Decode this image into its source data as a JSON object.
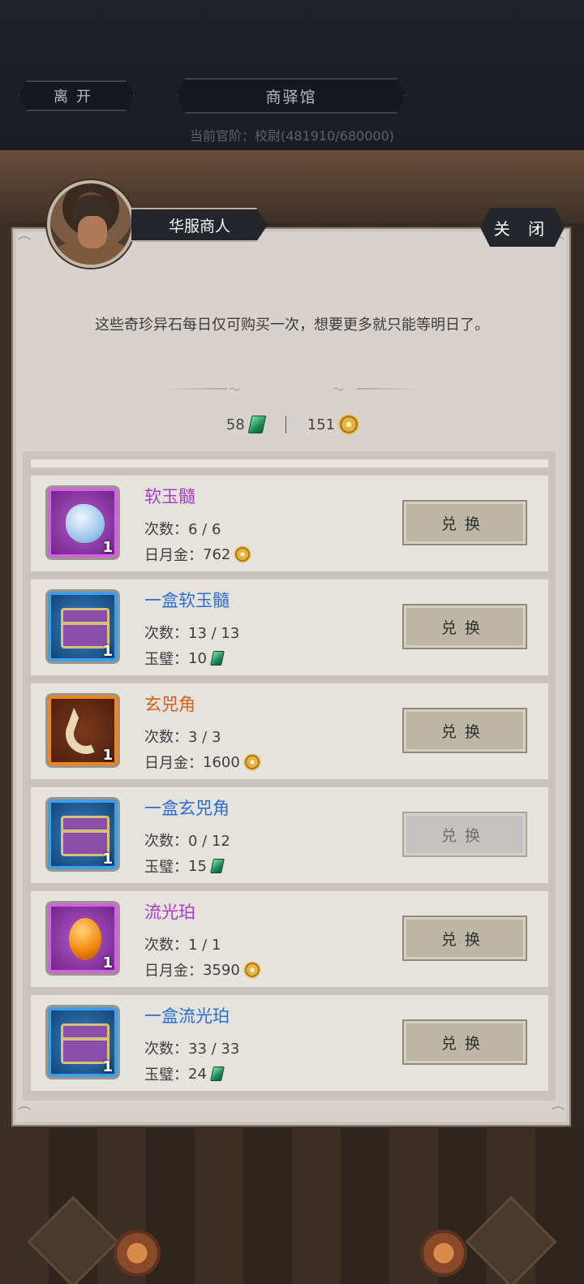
{
  "header": {
    "leave_label": "离开",
    "title": "商驿馆",
    "rank_text": "当前官阶：校尉(481910/680000)"
  },
  "dialog": {
    "merchant_name": "华服商人",
    "close_label": "关 闭",
    "message": "这些奇珍异石每日仅可购买一次，想要更多就只能等明日了。"
  },
  "currency": {
    "jade": "58",
    "gold": "151"
  },
  "items": [
    {
      "name": "软玉髓",
      "rarity": "purple",
      "icon": "blue-jade-stone-icon",
      "qty": "1",
      "count": "次数：6 / 6",
      "cost_label": "日月金：",
      "cost": "762",
      "cost_icon": "gold",
      "button": "兑换",
      "enabled": true
    },
    {
      "name": "一盒软玉髓",
      "rarity": "blue",
      "icon": "treasure-chest-icon",
      "qty": "1",
      "count": "次数：13 / 13",
      "cost_label": "玉璧：",
      "cost": "10",
      "cost_icon": "jade",
      "button": "兑换",
      "enabled": true
    },
    {
      "name": "玄兕角",
      "rarity": "orange",
      "icon": "horn-icon",
      "qty": "1",
      "count": "次数：3 / 3",
      "cost_label": "日月金：",
      "cost": "1600",
      "cost_icon": "gold",
      "button": "兑换",
      "enabled": true
    },
    {
      "name": "一盒玄兕角",
      "rarity": "blue",
      "icon": "treasure-chest-icon",
      "qty": "1",
      "count": "次数：0 / 12",
      "cost_label": "玉璧：",
      "cost": "15",
      "cost_icon": "jade",
      "button": "兑换",
      "enabled": false
    },
    {
      "name": "流光珀",
      "rarity": "purple",
      "icon": "amber-gem-icon",
      "qty": "1",
      "count": "次数：1 / 1",
      "cost_label": "日月金：",
      "cost": "3590",
      "cost_icon": "gold",
      "button": "兑换",
      "enabled": true
    },
    {
      "name": "一盒流光珀",
      "rarity": "blue",
      "icon": "treasure-chest-icon",
      "qty": "1",
      "count": "次数：33 / 33",
      "cost_label": "玉璧：",
      "cost": "24",
      "cost_icon": "jade",
      "button": "兑换",
      "enabled": true
    }
  ]
}
